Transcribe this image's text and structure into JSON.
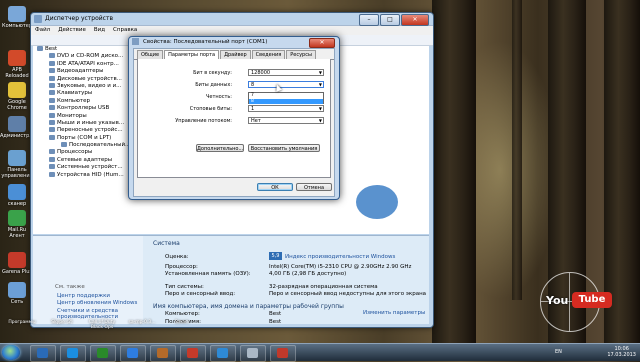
{
  "desktop_icons": [
    {
      "label": "Компьютер",
      "color": "#7aa7d8"
    },
    {
      "label": "APB Reloaded",
      "color": "#d24a2a"
    },
    {
      "label": "Google Chrome",
      "color": "#e3c13a"
    },
    {
      "label": "Администр...",
      "color": "#5f7fa8"
    },
    {
      "label": "Панель управления",
      "color": "#6aa0d0"
    },
    {
      "label": "сканер",
      "color": "#4b8fd6"
    },
    {
      "label": "Mail.Ru Агент",
      "color": "#3aa24a"
    },
    {
      "label": "Garena Plus",
      "color": "#c43a2a"
    },
    {
      "label": "Сеть",
      "color": "#6c9fd6"
    }
  ],
  "taskbar_icon_labels": [
    "Программы",
    "Skype (2)",
    "Call of Duty Black Ops",
    "sa-mp-0.3...",
    "Steam"
  ],
  "window": {
    "title": "Диспетчер устройств",
    "menu": [
      "Файл",
      "Действие",
      "Вид",
      "Справка"
    ],
    "tree": [
      "Best",
      "DVD и CD-ROM диско...",
      "IDE ATA/ATAPI контр...",
      "Видеоадаптеры",
      "Дисковые устройств...",
      "Звуковые, видео и и...",
      "Клавиатуры",
      "Компьютер",
      "Контроллеры USB",
      "Мониторы",
      "Мыши и иные указыв...",
      "Переносные устройс...",
      "Порты (COM и LPT)",
      "Последовательный...",
      "Процессоры",
      "Сетевые адаптеры",
      "Системные устройст...",
      "Устройства HID (Hum..."
    ]
  },
  "sysinfo": {
    "see_also": "См. также",
    "links": [
      "Центр поддержки",
      "Центр обновления Windows",
      "Счетчики и средства производительности"
    ],
    "section_title": "Система",
    "rows": [
      {
        "key": "Оценка:",
        "value": "Индекс производительности Windows"
      },
      {
        "key": "Процессор:",
        "value": "Intel(R) Core(TM) i5-2310 CPU @ 2.90GHz   2.90 GHz"
      },
      {
        "key": "Установленная память (ОЗУ):",
        "value": "4,00 ГБ (2,98 ГБ доступно)"
      },
      {
        "key": "Тип системы:",
        "value": "32-разрядная операционная система"
      },
      {
        "key": "Перо и сенсорный ввод:",
        "value": "Перо и сенсорный ввод недоступны для этого экрана"
      }
    ],
    "section2_title": "Имя компьютера, имя домена и параметры рабочей группы",
    "rows2": [
      {
        "key": "Компьютер:",
        "value": "Best"
      },
      {
        "key": "Полное имя:",
        "value": "Best"
      }
    ],
    "change_params": "Изменить параметры",
    "wei_score": "5,9"
  },
  "dialog": {
    "title": "Свойства: Последовательный порт (COM1)",
    "tabs": [
      "Общие",
      "Параметры порта",
      "Драйвер",
      "Сведения",
      "Ресурсы"
    ],
    "active_tab": 1,
    "fields": [
      {
        "label": "Бит в секунду:",
        "value": "128000"
      },
      {
        "label": "Биты данных:",
        "value": "8"
      },
      {
        "label": "Четность:",
        "value": "Нет"
      },
      {
        "label": "Стоповые биты:",
        "value": "1"
      },
      {
        "label": "Управление потоком:",
        "value": "Нет"
      }
    ],
    "dropdown_options": [
      "7",
      "8"
    ],
    "dropdown_selected": 1,
    "buttons": {
      "advanced": "Дополнительно...",
      "restore": "Восстановить умолчания",
      "ok": "ОК",
      "cancel": "Отмена"
    }
  },
  "watermark": {
    "you": "You",
    "tube": "Tube"
  },
  "tray": {
    "lang": "EN",
    "time": "10:06",
    "date": "17.03.2013"
  }
}
